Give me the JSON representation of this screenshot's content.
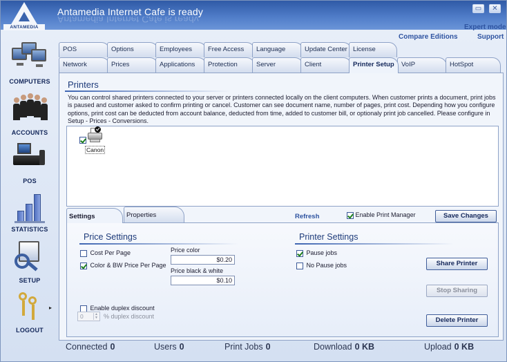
{
  "header": {
    "title": "Antamedia Internet Cafe is ready",
    "logo_text": "ANTAMEDIA",
    "minimize_glyph": "▭",
    "close_glyph": "✕"
  },
  "links": {
    "expert_mode": "Expert mode",
    "compare_editions": "Compare Editions",
    "support": "Support"
  },
  "sidebar": {
    "items": [
      {
        "label": "COMPUTERS",
        "icon": "computers-icon"
      },
      {
        "label": "ACCOUNTS",
        "icon": "accounts-icon"
      },
      {
        "label": "POS",
        "icon": "pos-icon"
      },
      {
        "label": "STATISTICS",
        "icon": "statistics-icon"
      },
      {
        "label": "SETUP",
        "icon": "setup-icon"
      },
      {
        "label": "LOGOUT",
        "icon": "keys-icon"
      }
    ],
    "logout_arrow": "▸"
  },
  "tabs_row1": [
    "POS",
    "Options",
    "Employees",
    "Free Access",
    "Language",
    "Update Center",
    "License"
  ],
  "tabs_row2": [
    "Network",
    "Prices",
    "Applications",
    "Protection",
    "Server",
    "Client",
    "Printer Setup",
    "VoIP",
    "HotSpot"
  ],
  "active_tab": "Printer Setup",
  "section": {
    "title": "Printers",
    "description": "You can control shared printers connected to your server or printers connected locally on the client computers. When customer prints a document, print jobs is paused and customer asked to confirm printing or cancel. Customer can see document name, number of pages, print cost. Depending how you configure options, print cost can be deducted from account balance, deducted from time, added to customer bill, or optionaly print job cancelled. Please configure in Setup - Prices - Conversions."
  },
  "printers": [
    {
      "name": "Canon",
      "checked": true
    }
  ],
  "subtabs": {
    "settings": "Settings",
    "properties": "Properties"
  },
  "toolbar": {
    "refresh": "Refresh",
    "enable_print_manager": "Enable Print Manager",
    "save_changes": "Save Changes"
  },
  "price_settings": {
    "title": "Price Settings",
    "cost_per_page": "Cost Per Page",
    "color_bw": "Color & BW Price Per Page",
    "price_color_label": "Price color",
    "price_color_value": "$0.20",
    "price_bw_label": "Price black & white",
    "price_bw_value": "$0.10",
    "enable_duplex": "Enable duplex discount",
    "duplex_value": "0",
    "duplex_label": "% duplex discount"
  },
  "printer_settings": {
    "title": "Printer Settings",
    "pause_jobs": "Pause jobs",
    "no_pause_jobs": "No Pause jobs",
    "share_printer": "Share Printer",
    "stop_sharing": "Stop Sharing",
    "delete_printer": "Delete Printer"
  },
  "status": {
    "connected_label": "Connected",
    "connected_value": "0",
    "users_label": "Users",
    "users_value": "0",
    "print_jobs_label": "Print Jobs",
    "print_jobs_value": "0",
    "download_label": "Download",
    "download_value": "0 KB",
    "upload_label": "Upload",
    "upload_value": "0 KB"
  },
  "colors": {
    "header_blue": "#2f5aa6",
    "accent": "#1e3b7a",
    "link": "#2e53a0"
  }
}
